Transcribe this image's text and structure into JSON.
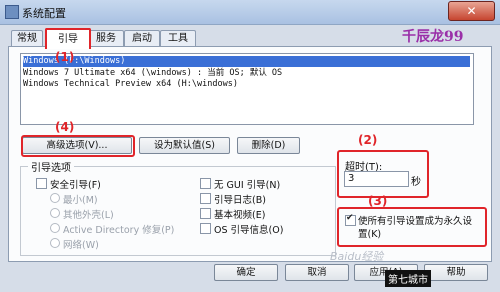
{
  "window": {
    "title": "系统配置",
    "close_label": "✕"
  },
  "tabs": [
    "常规",
    "引导",
    "服务",
    "启动",
    "工具"
  ],
  "watermark_top": "千辰龙99",
  "os_entries": [
    "Windows (F:\\Windows)",
    "Windows 7 Ultimate x64 (\\windows) : 当前 OS; 默认 OS",
    "Windows Technical Preview x64 (H:\\windows)"
  ],
  "buttons": {
    "advanced": "高级选项(V)...",
    "set_default": "设为默认值(S)",
    "delete": "删除(D)"
  },
  "boot_options": {
    "group_label": "引导选项",
    "safe_boot": "安全引导(F)",
    "minimal": "最小(M)",
    "alternate_shell": "其他外壳(L)",
    "active_directory": "Active Directory 修复(P)",
    "network": "网络(W)",
    "no_gui": "无 GUI 引导(N)",
    "boot_log": "引导日志(B)",
    "base_video": "基本视频(E)",
    "os_info": "OS 引导信息(O)"
  },
  "timeout": {
    "label": "超时(T):",
    "value": "3",
    "unit": "秒"
  },
  "make_permanent": {
    "label_line1": "使所有引导设置成为永久设",
    "label_line2": "置(K)",
    "checked": true
  },
  "dialog_buttons": {
    "ok": "确定",
    "cancel": "取消",
    "apply": "应用(A)",
    "help": "帮助"
  },
  "annotations": [
    "(1)",
    "(2)",
    "(3)",
    "(4)"
  ],
  "watermark_bottom": "第七城市",
  "watermark_faint": "Baidu经验",
  "colors": {
    "annotation": "#e0252a",
    "selection": "#3a6fd6"
  }
}
